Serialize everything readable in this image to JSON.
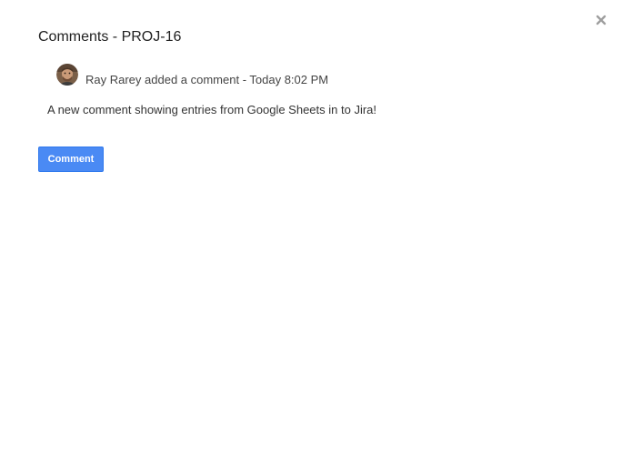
{
  "dialog": {
    "title": "Comments - PROJ-16",
    "close_icon": "close-icon"
  },
  "comment": {
    "author": "Ray Rarey",
    "meta": "Ray Rarey added a comment - Today 8:02 PM",
    "avatar_icon": "user-avatar",
    "body": "A new comment showing entries from Google Sheets in to Jira!"
  },
  "actions": {
    "comment_label": "Comment"
  },
  "colors": {
    "button_bg": "#4a8af4",
    "button_border": "#3079ed",
    "close_icon": "#9e9e9e"
  }
}
